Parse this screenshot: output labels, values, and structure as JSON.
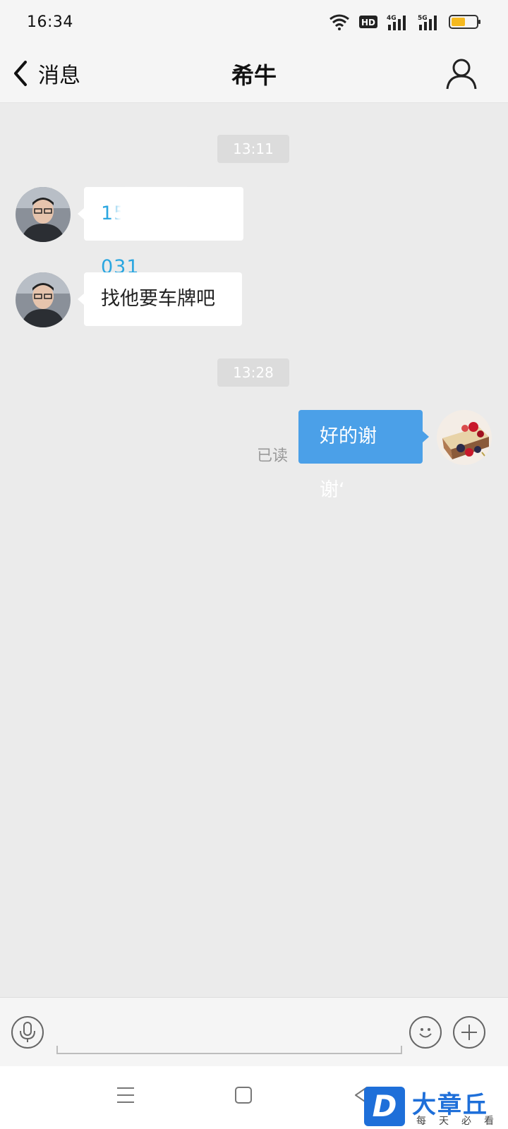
{
  "status_bar": {
    "time": "16:34",
    "icons": [
      "wifi-icon",
      "hd-badge-icon",
      "signal-4g-icon",
      "signal-5g-icon",
      "battery-icon"
    ],
    "hd_label": "HD",
    "net1_label": "4G",
    "net2_label": "5G",
    "battery_color": "#f5b91f"
  },
  "header": {
    "back_label": "消息",
    "title": "希牛",
    "profile_icon": "user-icon"
  },
  "chat": {
    "messages": [
      {
        "type": "time",
        "text": "13:11"
      },
      {
        "type": "incoming",
        "text": "15        031",
        "prefix": "15",
        "suffix": "031",
        "note": "phone number partly obscured"
      },
      {
        "type": "incoming",
        "text": "找他要车牌吧"
      },
      {
        "type": "time",
        "text": "13:28"
      },
      {
        "type": "outgoing",
        "text": "好的谢谢‘",
        "status": "已读"
      }
    ]
  },
  "input_bar": {
    "voice_icon": "microphone-icon",
    "emoji_icon": "smiley-icon",
    "plus_icon": "plus-icon",
    "placeholder": ""
  },
  "nav_bar": {
    "icons": [
      "menu-icon",
      "home-square-icon",
      "back-triangle-icon"
    ]
  },
  "watermark": {
    "logo_letter": "D",
    "title": "大章丘",
    "subtitle": "每天必看"
  },
  "colors": {
    "chat_bg": "#ebebeb",
    "outgoing_bubble": "#4ba0e8",
    "incoming_bubble": "#ffffff",
    "phone_link": "#2aa6e0",
    "watermark_blue": "#1e6fd9"
  }
}
